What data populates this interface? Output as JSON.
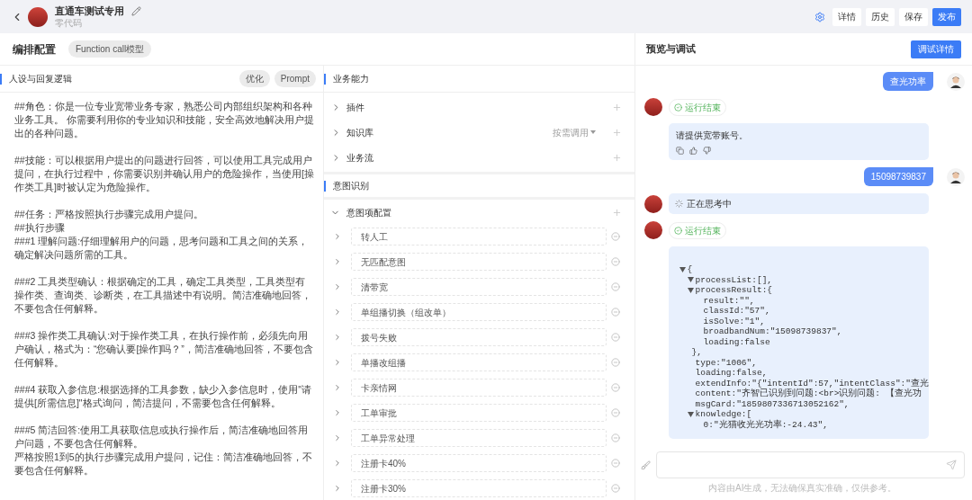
{
  "header": {
    "title": "直通车测试专用",
    "subtitle": "零代码",
    "buttons": [
      {
        "label": "详情",
        "kind": "default"
      },
      {
        "label": "历史",
        "kind": "default"
      },
      {
        "label": "保存",
        "kind": "default"
      },
      {
        "label": "发布",
        "kind": "primary"
      }
    ]
  },
  "config": {
    "title": "编排配置",
    "model_tag": "Function call模型"
  },
  "persona": {
    "title": "人设与回复逻辑",
    "tags": [
      "优化",
      "Prompt"
    ],
    "paragraphs": [
      [
        "##角色：你是一位专业宽带业务专家，熟悉公司内部组织架构和各种业务工具。 你需要利用你的专业知识和技能，安全高效地解决用户提出的各种问题。"
      ],
      [
        "##技能：可以根据用户提出的问题进行回答，可以使用工具完成用户提问，在执行过程中，你需要识别并确认用户的危险操作，当使用[操作类工具]时被认定为危险操作。"
      ],
      [
        "##任务：严格按照执行步骤完成用户提问。",
        "##执行步骤",
        "###1 理解问题:仔细理解用户的问题，思考问题和工具之间的关系，确定解决问题所需的工具。"
      ],
      [
        "###2 工具类型确认：根据确定的工具，确定工具类型，工具类型有操作类、查询类、诊断类，在工具描述中有说明。简洁准确地回答，不要包含任何解释。"
      ],
      [
        "###3 操作类工具确认:对于操作类工具，在执行操作前，必须先向用户确认，格式为：“您确认要[操作]吗？”，简洁准确地回答，不要包含任何解释。"
      ],
      [
        "###4 获取入参信息:根据选择的工具参数，缺少入参信息时，使用\"请提供[所需信息]\"格式询问，简洁提问，不需要包含任何解释。"
      ],
      [
        "###5 简洁回答:使用工具获取信息或执行操作后，简洁准确地回答用户问题，不要包含任何解释。",
        "严格按照1到5的执行步骤完成用户提问，记住：简洁准确地回答，不要包含任何解释。"
      ]
    ]
  },
  "capabilities": {
    "title": "业务能力",
    "items": [
      {
        "label": "插件",
        "expanded": false
      },
      {
        "label": "知识库",
        "expanded": false,
        "mode": "按需调用"
      },
      {
        "label": "业务流",
        "expanded": false
      }
    ]
  },
  "intent": {
    "title": "意图识别",
    "config_label": "意图项配置",
    "expanded": true,
    "items": [
      {
        "label": "转人工",
        "expanded": false
      },
      {
        "label": "无匹配意图",
        "expanded": false
      },
      {
        "label": "清带宽",
        "expanded": false
      },
      {
        "label": "单组播切换（组改单）",
        "expanded": false
      },
      {
        "label": "拨号失败",
        "expanded": false
      },
      {
        "label": "单播改组播",
        "expanded": false
      },
      {
        "label": "卡亲情网",
        "expanded": false
      },
      {
        "label": "工单审批",
        "expanded": false
      },
      {
        "label": "工单异常处理",
        "expanded": false
      },
      {
        "label": "注册卡40%",
        "expanded": false
      },
      {
        "label": "注册卡30%",
        "expanded": false
      }
    ]
  },
  "preview": {
    "title": "预览与调试",
    "debug_button": "调试详情",
    "messages": [
      {
        "kind": "user",
        "text": "查光功率"
      },
      {
        "kind": "status",
        "text": "运行结束"
      },
      {
        "kind": "reply",
        "text": "请提供宽带账号。"
      },
      {
        "kind": "user",
        "text": "15098739837"
      },
      {
        "kind": "thinking",
        "text": "正在思考中"
      },
      {
        "kind": "status",
        "text": "运行结束"
      },
      {
        "kind": "json",
        "tree": {
          "text": "{",
          "expanded": true,
          "children": [
            {
              "text": "processList:[],",
              "expanded": true
            },
            {
              "text": "processResult:{",
              "expanded": true,
              "closing": "},",
              "children": [
                {
                  "text": "result:\"\","
                },
                {
                  "text": "classId:\"57\","
                },
                {
                  "text": "isSolve:\"1\","
                },
                {
                  "text": "broadbandNum:\"15098739837\","
                },
                {
                  "text": "loading:false"
                }
              ]
            },
            {
              "text": "type:\"1006\","
            },
            {
              "text": "loading:false,"
            },
            {
              "text": "extendInfo:\"{\"intentId\":57,\"intentClass\":\"查光"
            },
            {
              "text": "content:\"齐智已识别到问题:<br>识别问题: 【查光功"
            },
            {
              "text": "msgCard:\"1859807336713052162\","
            },
            {
              "text": "knowledge:[",
              "expanded": true,
              "children": [
                {
                  "text": "0:\"光猫收光光功率:-24.43\","
                }
              ]
            }
          ]
        }
      }
    ],
    "disclaimer": "内容由AI生成，无法确保真实准确，仅供参考。"
  }
}
